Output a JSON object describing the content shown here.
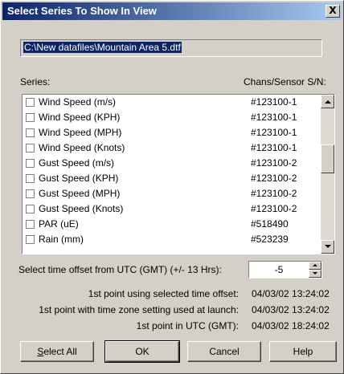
{
  "window": {
    "title": "Select Series To Show In View",
    "close_glyph": "X"
  },
  "file_path": "C:\\New datafiles\\Mountain Area 5.dtf",
  "list_headers": {
    "series": "Series:",
    "sn": "Chans/Sensor S/N:"
  },
  "series": [
    {
      "name": "Wind Speed (m/s)",
      "sn": "#123100-1",
      "checked": false
    },
    {
      "name": "Wind Speed (KPH)",
      "sn": "#123100-1",
      "checked": false
    },
    {
      "name": "Wind Speed (MPH)",
      "sn": "#123100-1",
      "checked": false
    },
    {
      "name": "Wind Speed (Knots)",
      "sn": "#123100-1",
      "checked": false
    },
    {
      "name": "Gust Speed (m/s)",
      "sn": "#123100-2",
      "checked": false
    },
    {
      "name": "Gust Speed (KPH)",
      "sn": "#123100-2",
      "checked": false
    },
    {
      "name": "Gust Speed (MPH)",
      "sn": "#123100-2",
      "checked": false
    },
    {
      "name": "Gust Speed (Knots)",
      "sn": "#123100-2",
      "checked": false
    },
    {
      "name": "PAR (uE)",
      "sn": "#518490",
      "checked": false
    },
    {
      "name": "Rain (mm)",
      "sn": "#523239",
      "checked": false
    }
  ],
  "offset": {
    "label": "Select time offset from UTC (GMT) (+/- 13 Hrs):",
    "value": "-5"
  },
  "info": [
    {
      "label": "1st point using selected time offset:",
      "value": "04/03/02 13:24:02"
    },
    {
      "label": "1st point with time zone setting used at launch:",
      "value": "04/03/02 13:24:02"
    },
    {
      "label": "1st point in UTC (GMT):",
      "value": "04/03/02 18:24:02"
    }
  ],
  "buttons": {
    "select_all_first": "S",
    "select_all_rest": "elect All",
    "ok": "OK",
    "cancel": "Cancel",
    "help": "Help"
  }
}
